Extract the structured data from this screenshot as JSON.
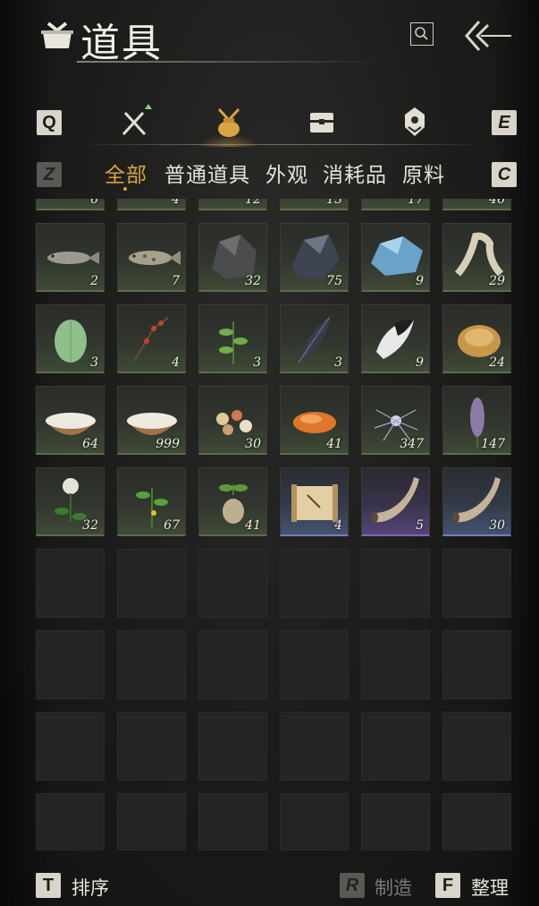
{
  "header": {
    "title": "道具"
  },
  "keys": {
    "prev_category": "Q",
    "next_category": "E",
    "prev_filter": "Z",
    "next_filter": "C",
    "sort": "T",
    "craft": "R",
    "organize": "F"
  },
  "filters": [
    {
      "label": "全部",
      "active": true
    },
    {
      "label": "普通道具",
      "active": false
    },
    {
      "label": "外观",
      "active": false
    },
    {
      "label": "消耗品",
      "active": false
    },
    {
      "label": "原料",
      "active": false
    }
  ],
  "inventory": {
    "items": [
      {
        "count": "6",
        "icon": "partial-item-icon",
        "rarity": "green"
      },
      {
        "count": "4",
        "icon": "partial-item-icon",
        "rarity": "green"
      },
      {
        "count": "12",
        "icon": "partial-item-icon",
        "rarity": "green"
      },
      {
        "count": "13",
        "icon": "partial-item-icon",
        "rarity": "green"
      },
      {
        "count": "17",
        "icon": "partial-item-icon",
        "rarity": "green"
      },
      {
        "count": "46",
        "icon": "partial-item-icon",
        "rarity": "green"
      },
      {
        "count": "2",
        "icon": "fish-icon",
        "rarity": "green"
      },
      {
        "count": "7",
        "icon": "spotted-fish-icon",
        "rarity": "green"
      },
      {
        "count": "32",
        "icon": "dark-ore-icon",
        "rarity": "green"
      },
      {
        "count": "75",
        "icon": "black-ore-icon",
        "rarity": "green"
      },
      {
        "count": "9",
        "icon": "blue-crystal-ore-icon",
        "rarity": "green"
      },
      {
        "count": "29",
        "icon": "bone-icon",
        "rarity": "green"
      },
      {
        "count": "3",
        "icon": "melon-icon",
        "rarity": "green"
      },
      {
        "count": "4",
        "icon": "berry-branch-icon",
        "rarity": "green"
      },
      {
        "count": "3",
        "icon": "herb-icon",
        "rarity": "green"
      },
      {
        "count": "3",
        "icon": "dark-feather-icon",
        "rarity": "green"
      },
      {
        "count": "9",
        "icon": "fur-tuft-icon",
        "rarity": "green"
      },
      {
        "count": "24",
        "icon": "carved-shell-icon",
        "rarity": "green"
      },
      {
        "count": "64",
        "icon": "milk-bowl-icon",
        "rarity": "green"
      },
      {
        "count": "999",
        "icon": "milk-bowl-icon",
        "rarity": "green"
      },
      {
        "count": "30",
        "icon": "pebbles-icon",
        "rarity": "green"
      },
      {
        "count": "41",
        "icon": "orange-stone-icon",
        "rarity": "green"
      },
      {
        "count": "347",
        "icon": "silver-spider-icon",
        "rarity": "green"
      },
      {
        "count": "147",
        "icon": "purple-flower-spike-icon",
        "rarity": "green"
      },
      {
        "count": "32",
        "icon": "white-flower-icon",
        "rarity": "green"
      },
      {
        "count": "67",
        "icon": "yellow-flower-icon",
        "rarity": "green"
      },
      {
        "count": "41",
        "icon": "ginseng-root-icon",
        "rarity": "green"
      },
      {
        "count": "4",
        "icon": "scroll-icon",
        "rarity": "blue"
      },
      {
        "count": "5",
        "icon": "horn-icon",
        "rarity": "purple"
      },
      {
        "count": "30",
        "icon": "horn-icon",
        "rarity": "blue"
      }
    ]
  },
  "footer": {
    "sort_label": "排序",
    "craft_label": "制造",
    "organize_label": "整理"
  }
}
